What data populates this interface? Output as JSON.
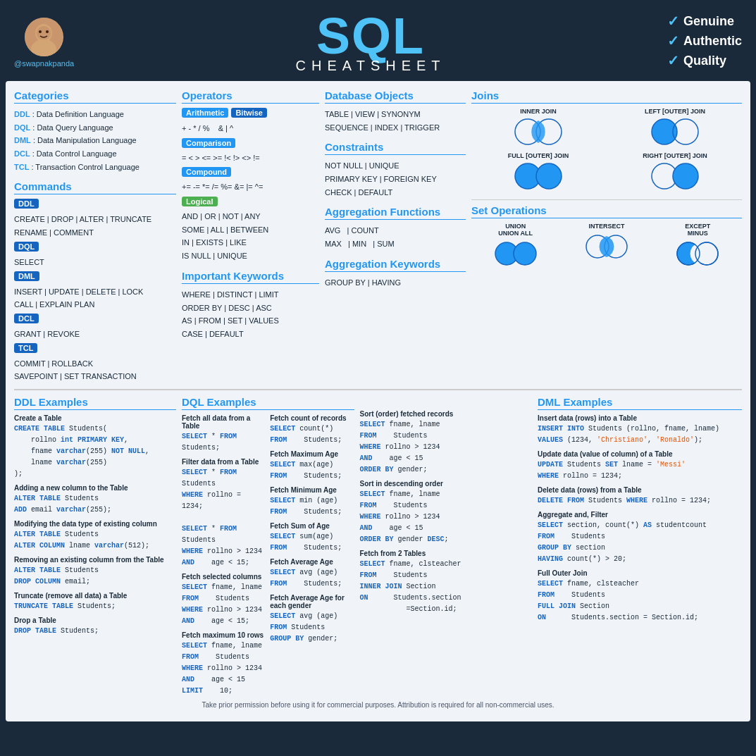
{
  "header": {
    "twitter": "@swapnakpanda",
    "title": "SQL",
    "subtitle": "CHEATSHEET",
    "badges": [
      "Genuine",
      "Authentic",
      "Quality"
    ]
  },
  "categories": {
    "title": "Categories",
    "items": [
      {
        "abbr": "DDL",
        "full": ": Data Definition Language"
      },
      {
        "abbr": "DQL",
        "full": ": Data Query Language"
      },
      {
        "abbr": "DML",
        "full": ": Data Manipulation Language"
      },
      {
        "abbr": "DCL",
        "full": ": Data Control Language"
      },
      {
        "abbr": "TCL",
        "full": ": Transaction Control Language"
      }
    ]
  },
  "commands": {
    "title": "Commands",
    "ddl": "CREATE | DROP | ALTER | TRUNCATE\nRENAME | COMMENT",
    "dql": "SELECT",
    "dml": "INSERT | UPDATE | DELETE | LOCK\nCALL | EXPLAIN PLAN",
    "dcl": "GRANT | REVOKE",
    "tcl": "COMMIT | ROLLBACK\nSAVEPOINT | SET TRANSACTION"
  },
  "operators": {
    "title": "Operators",
    "arithmetic_label": "Arithmetic",
    "bitwise_label": "Bitwise",
    "arithmetic_ops": "+ - * / %",
    "bitwise_ops": "& | ^",
    "comparison_label": "Comparison",
    "comparison_ops": "= < > <= >= !< !> <> !=",
    "compound_label": "Compound",
    "compound_ops": "+= -= *= /= %= &= |= ^=",
    "logical_label": "Logical",
    "logical_ops": "AND | OR | NOT | ANY\nSOME | ALL | BETWEEN\nIN | EXISTS | LIKE\nIS NULL | UNIQUE"
  },
  "important_keywords": {
    "title": "Important Keywords",
    "items": "WHERE | DISTINCT | LIMIT\nORDER BY | DESC | ASC\nAS | FROM | SET | VALUES\nCASE | DEFAULT"
  },
  "database_objects": {
    "title": "Database Objects",
    "items": "TABLE | VIEW | SYNONYM\nSEQUENCE | INDEX | TRIGGER"
  },
  "constraints": {
    "title": "Constraints",
    "items": "NOT NULL | UNIQUE\nPRIMARY KEY | FOREIGN KEY\nCHECK | DEFAULT"
  },
  "aggregation_functions": {
    "title": "Aggregation Functions",
    "items": "AVG | COUNT\nMAX | MIN | SUM"
  },
  "aggregation_keywords": {
    "title": "Aggregation Keywords",
    "items": "GROUP BY | HAVING"
  },
  "joins": {
    "title": "Joins",
    "items": [
      {
        "label": "INNER JOIN",
        "type": "inner"
      },
      {
        "label": "LEFT [OUTER] JOIN",
        "type": "left"
      },
      {
        "label": "FULL [OUTER] JOIN",
        "type": "full"
      },
      {
        "label": "RIGHT [OUTER] JOIN",
        "type": "right"
      }
    ]
  },
  "set_operations": {
    "title": "Set Operations",
    "items": [
      {
        "label": "UNION\nUNION ALL",
        "type": "union"
      },
      {
        "label": "INTERSECT",
        "type": "intersect"
      },
      {
        "label": "EXCEPT\nMINUS",
        "type": "except"
      }
    ]
  },
  "ddl_examples": {
    "title": "DDL Examples",
    "examples": [
      {
        "desc": "Create a Table",
        "code": "CREATE TABLE Students(\n    rollno int PRIMARY KEY,\n    fname varchar(255) NOT NULL,\n    lname varchar(255)\n);"
      },
      {
        "desc": "Adding a new column to the Table",
        "code": "ALTER TABLE Students\nADD email varchar(255);"
      },
      {
        "desc": "Modifying the data type of existing column",
        "code": "ALTER TABLE Students\nALTER COLUMN lname varchar(512);"
      },
      {
        "desc": "Removing an existing column from the Table",
        "code": "ALTER TABLE Students\nDROP COLUMN email;"
      },
      {
        "desc": "Truncate (remove all data) a Table",
        "code": "TRUNCATE TABLE Students;"
      },
      {
        "desc": "Drop a Table",
        "code": "DROP TABLE Students;"
      }
    ]
  },
  "dql_examples": {
    "title": "DQL Examples",
    "examples": [
      {
        "desc": "Fetch all data from a Table",
        "code": "SELECT * FROM Students;"
      },
      {
        "desc": "Filter data from a Table",
        "code": "SELECT * FROM Students\nWHERE rollno = 1234;\n\nSELECT * FROM Students\nWHERE rollno > 1234\nAND    age < 15;"
      },
      {
        "desc": "Fetch selected columns",
        "code": "SELECT fname, lname\nFROM    Students\nWHERE rollno > 1234\nAND    age < 15;"
      },
      {
        "desc": "Fetch maximum 10 rows",
        "code": "SELECT fname, lname\nFROM    Students\nWHERE rollno > 1234\nAND    age < 15\nLIMIT    10;"
      }
    ],
    "examples2": [
      {
        "desc": "Fetch count of records",
        "code": "SELECT count(*)\nFROM    Students;"
      },
      {
        "desc": "Fetch Maximum Age",
        "code": "SELECT max(age)\nFROM    Students;"
      },
      {
        "desc": "Fetch Minimum Age",
        "code": "SELECT min (age)\nFROM    Students;"
      },
      {
        "desc": "Fetch Sum of Age",
        "code": "SELECT sum(age)\nFROM    Students;"
      },
      {
        "desc": "Fetch Average Age",
        "code": "SELECT avg (age)\nFROM    Students;"
      },
      {
        "desc": "Fetch Average Age for each gender",
        "code": "SELECT avg (age)\nFROM Students\nGROUP BY gender;"
      }
    ],
    "examples3": [
      {
        "desc": "Sort (order) fetched records",
        "code": "SELECT fname, lname\nFROM    Students\nWHERE rollno > 1234\nAND    age < 15\nORDER BY gender;"
      },
      {
        "desc": "Sort in descending order",
        "code": "SELECT fname, lname\nFROM    Students\nWHERE rollno > 1234\nAND    age < 15\nORDER BY gender DESC;"
      },
      {
        "desc": "Fetch from 2 Tables",
        "code": "SELECT fname, clsteacher\nFROM    Students\nINNER JOIN Section\nON        Students.section\n           =Section.id;"
      }
    ]
  },
  "dml_examples": {
    "title": "DML Examples",
    "examples": [
      {
        "desc": "Insert data (rows) into a Table",
        "code": "INSERT INTO Students (rollno, fname, lname)\nVALUES (1234, 'Christiano', 'Ronaldo');"
      },
      {
        "desc": "Update data (value of column) of a Table",
        "code": "UPDATE Students SET lname = 'Messi'\nWHERE rollno = 1234;"
      },
      {
        "desc": "Delete data (rows) from a Table",
        "code": "DELETE FROM Students WHERE rollno = 1234;"
      },
      {
        "desc": "Aggregate and, Filter",
        "code": "SELECT section, count(*) AS studentcount\nFROM    Students\nGROUP BY section\nHAVING count(*) > 20;"
      },
      {
        "desc": "Full Outer Join",
        "code": "SELECT fname, clsteacher\nFROM    Students\nFULL JOIN Section\nON        Students.section = Section.id;"
      }
    ]
  },
  "footer": {
    "text": "Take prior permission before using it for commercial purposes. Attribution is required for all non-commercial uses."
  }
}
